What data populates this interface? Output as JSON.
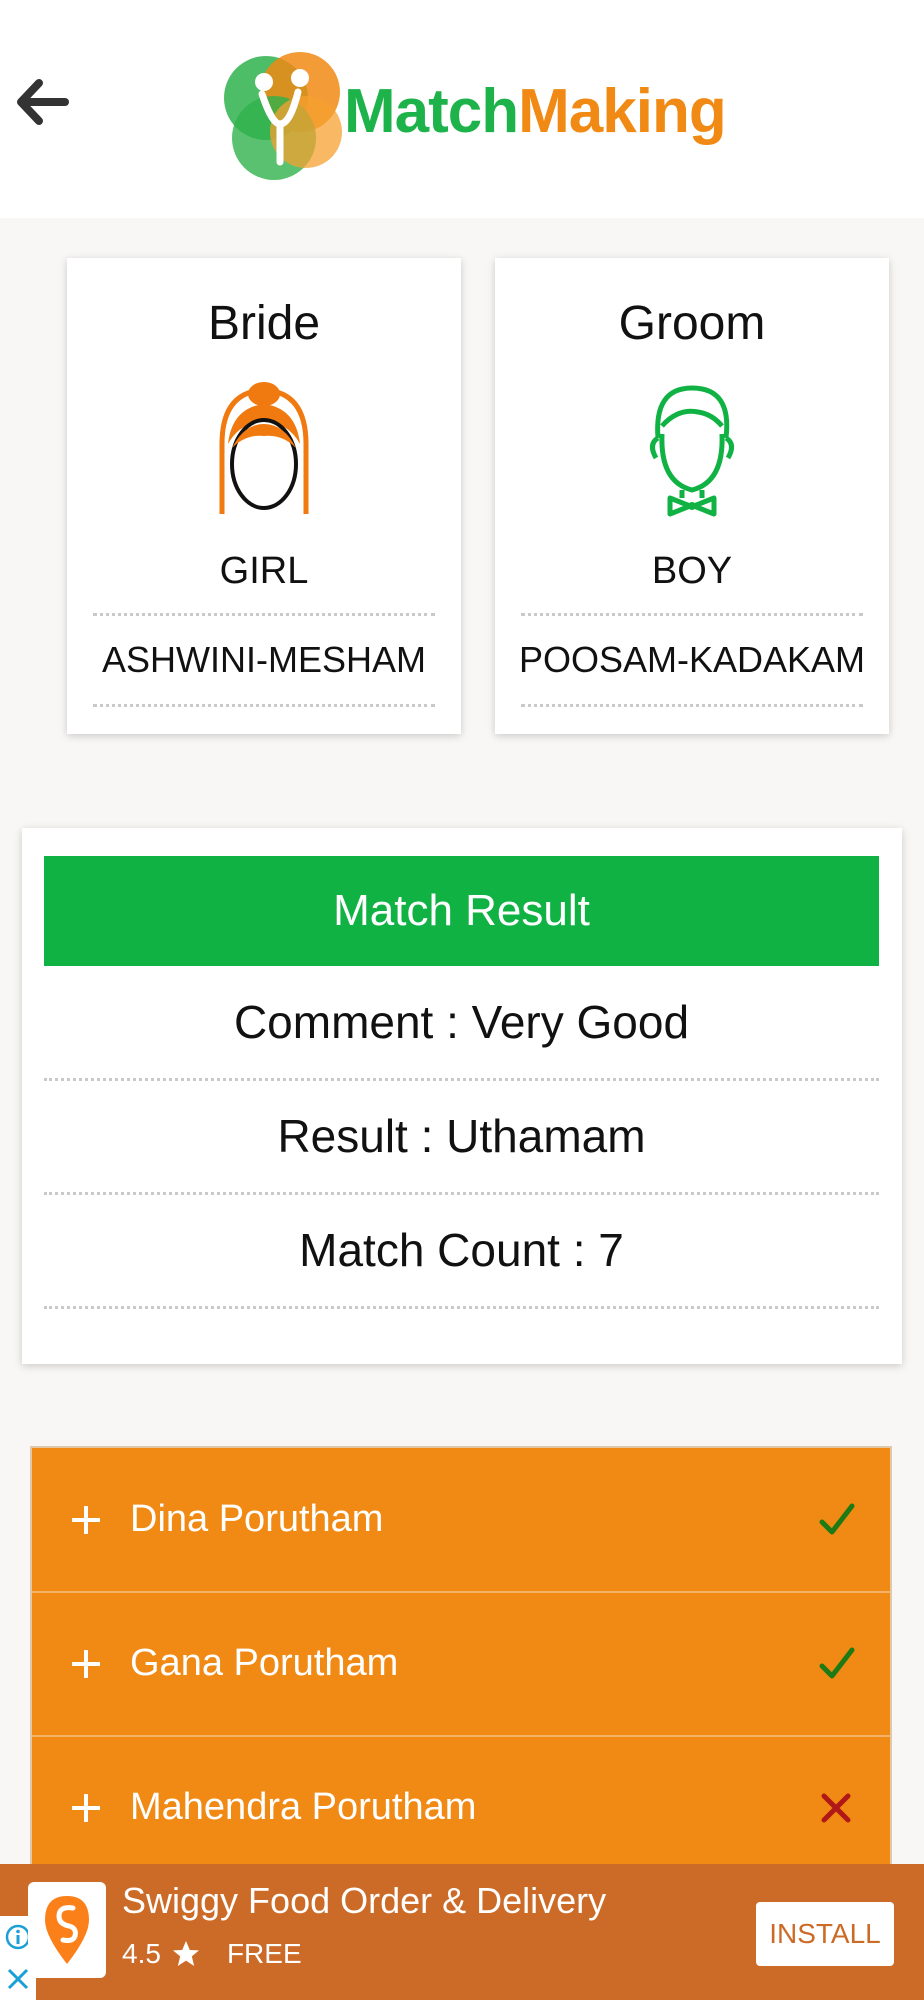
{
  "header": {
    "logo_match": "Match",
    "logo_making": "Making",
    "back_icon": "arrow-left-icon"
  },
  "bride": {
    "title": "Bride",
    "gender": "GIRL",
    "star": "ASHWINI-MESHAM",
    "icon": "bride-icon",
    "color": "#f07a10"
  },
  "groom": {
    "title": "Groom",
    "gender": "BOY",
    "star": "POOSAM-KADAKAM",
    "icon": "groom-icon",
    "color": "#11b244"
  },
  "result": {
    "heading": "Match Result",
    "comment": "Comment : Very Good",
    "result": "Result : Uthamam",
    "match_count": "Match Count : 7"
  },
  "poruthams": [
    {
      "label": "Dina Porutham",
      "matched": true
    },
    {
      "label": "Gana Porutham",
      "matched": true
    },
    {
      "label": "Mahendra Porutham",
      "matched": false
    }
  ],
  "ad": {
    "title": "Swiggy Food Order & Delivery",
    "rating": "4.5",
    "price": "FREE",
    "install_label": "INSTALL"
  },
  "colors": {
    "accent_green": "#11b244",
    "accent_orange": "#f08a14",
    "ad_background": "#cc6b27",
    "check_green": "#1e7a14",
    "cross_red": "#b01818"
  }
}
